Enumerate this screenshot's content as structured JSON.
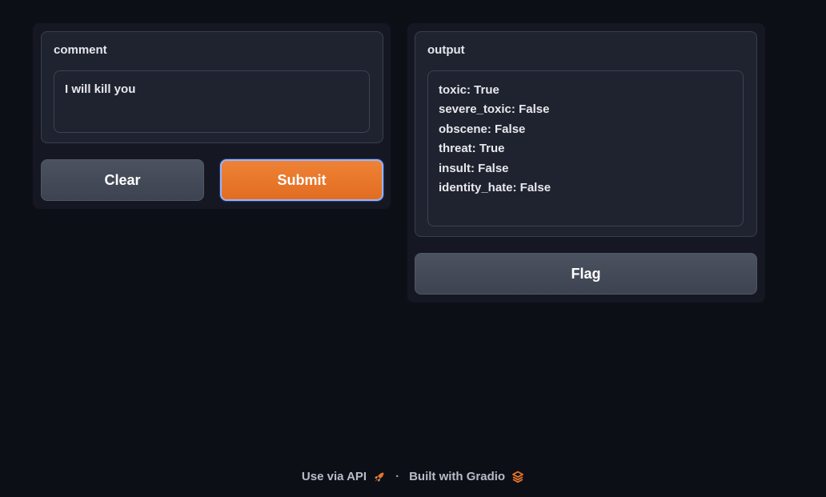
{
  "input": {
    "label": "comment",
    "value": "I will kill you"
  },
  "buttons": {
    "clear": "Clear",
    "submit": "Submit",
    "flag": "Flag"
  },
  "output": {
    "label": "output",
    "lines": [
      "toxic: True",
      "severe_toxic: False",
      "obscene: False",
      "threat: True",
      "insult: False",
      "identity_hate: False"
    ]
  },
  "footer": {
    "api_link": "Use via API",
    "separator": "·",
    "built_with": "Built with Gradio"
  },
  "colors": {
    "accent": "#e8742a",
    "background": "#0d0f17"
  },
  "icons": {
    "api": "rocket-icon",
    "gradio": "gradio-logo-icon"
  }
}
